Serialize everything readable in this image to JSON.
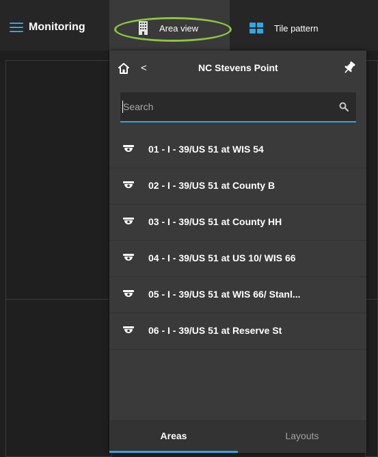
{
  "topbar": {
    "menu_label": "Monitoring",
    "area_view_label": "Area view",
    "tile_pattern_label": "Tile pattern"
  },
  "panel": {
    "title": "NC Stevens Point",
    "back_glyph": "<",
    "search": {
      "placeholder": "Search",
      "value": ""
    },
    "items": [
      {
        "label": "01 - I - 39/US 51 at WIS 54"
      },
      {
        "label": "02 - I - 39/US 51 at County B"
      },
      {
        "label": "03 - I - 39/US 51 at County HH"
      },
      {
        "label": "04 - I - 39/US 51 at US 10/ WIS 66"
      },
      {
        "label": "05 - I - 39/US 51 at WIS 66/ Stanl..."
      },
      {
        "label": "06 - I - 39/US 51 at Reserve St"
      }
    ],
    "footer_tabs": [
      {
        "label": "Areas",
        "active": true
      },
      {
        "label": "Layouts",
        "active": false
      }
    ]
  },
  "icons": [
    "menu-icon",
    "building-icon",
    "tile-pattern-icon",
    "home-icon",
    "back-icon",
    "pin-icon",
    "search-icon",
    "camera-icon"
  ],
  "colors": {
    "accent": "#2fa7e4",
    "highlight": "#8cc63f",
    "panel": "#3a3a3a",
    "background": "#1f1f1f"
  }
}
